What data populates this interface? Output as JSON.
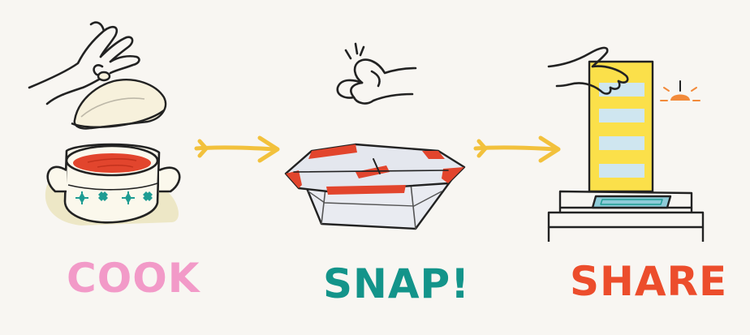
{
  "steps": [
    {
      "label": "COOK",
      "color": "#f29ac8",
      "icon": "cooking-pot-icon"
    },
    {
      "label": "SNAP!",
      "color": "#13948a",
      "icon": "food-container-icon"
    },
    {
      "label": "SHARE",
      "color": "#ec4d2c",
      "icon": "door-with-doormat-icon"
    }
  ],
  "colors": {
    "background": "#f8f6f2",
    "arrow": "#f2c13c",
    "outline": "#222222",
    "soup": "#e2452d",
    "door": "#fbe04a",
    "door_window": "#cfe6f0",
    "mat": "#8ecbd8",
    "pot_body": "#fbf8ec",
    "pot_shadow": "#ede7c6",
    "pot_pattern": "#1e9c93",
    "lamp": "#f28a3a"
  }
}
